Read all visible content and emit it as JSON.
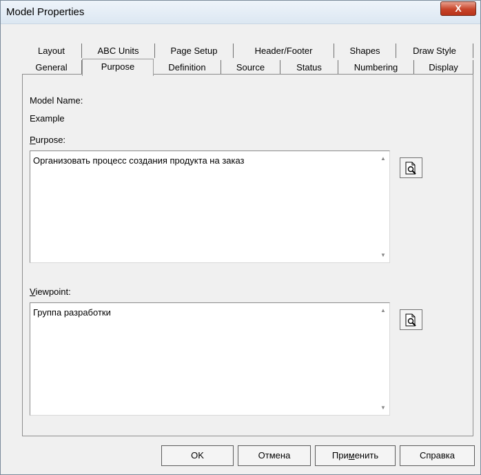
{
  "window": {
    "title": "Model Properties",
    "close_glyph": "X"
  },
  "tabs_row1": [
    {
      "label": "Layout"
    },
    {
      "label": "ABC Units"
    },
    {
      "label": "Page Setup"
    },
    {
      "label": "Header/Footer"
    },
    {
      "label": "Shapes"
    },
    {
      "label": "Draw Style"
    }
  ],
  "tabs_row2": [
    {
      "label": "General"
    },
    {
      "label": "Purpose",
      "active": true
    },
    {
      "label": "Definition"
    },
    {
      "label": "Source"
    },
    {
      "label": "Status"
    },
    {
      "label": "Numbering"
    },
    {
      "label": "Display"
    }
  ],
  "model_name": {
    "label": "Model Name:",
    "value": "Example"
  },
  "purpose": {
    "label_key": "P",
    "label_rest": "urpose:",
    "value": "Организовать процесс создания продукта на заказ"
  },
  "viewpoint": {
    "label_key": "V",
    "label_rest": "iewpoint:",
    "value": "Группа разработки"
  },
  "icons": {
    "browse": "magnifier-page-icon",
    "close": "close-icon"
  },
  "buttons": {
    "ok": "OK",
    "cancel": "Отмена",
    "apply_pre": "При",
    "apply_key": "м",
    "apply_post": "енить",
    "help": "Справка"
  }
}
